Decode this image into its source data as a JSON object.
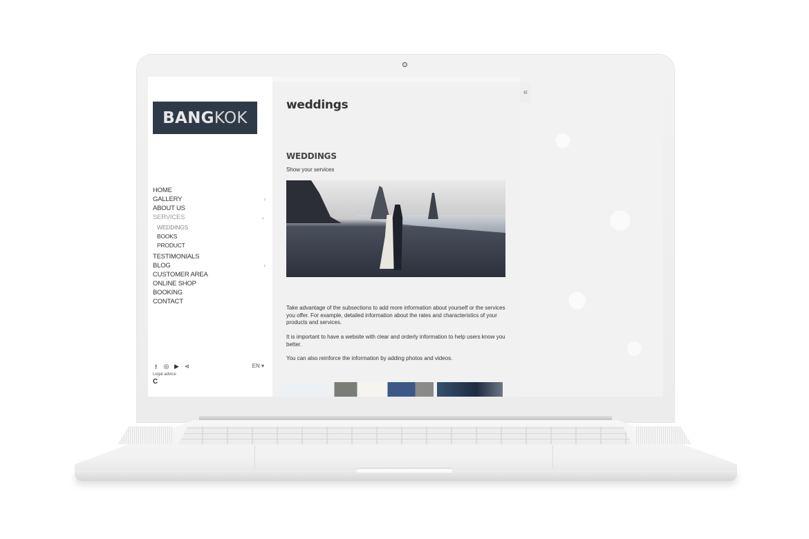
{
  "site": {
    "logo": {
      "bold": "BANG",
      "light": "KOK"
    },
    "nav": [
      {
        "label": "HOME",
        "has_submenu": false
      },
      {
        "label": "GALLERY",
        "has_submenu": true,
        "chevron": "chevron-right"
      },
      {
        "label": "ABOUT US",
        "has_submenu": false
      },
      {
        "label": "SERVICES",
        "has_submenu": true,
        "expanded": true,
        "chevron": "chevron-down",
        "children": [
          {
            "label": "WEDDINGS",
            "active": true
          },
          {
            "label": "BOOKS"
          },
          {
            "label": "PRODUCT"
          }
        ]
      },
      {
        "label": "TESTIMONIALS",
        "has_submenu": false
      },
      {
        "label": "BLOG",
        "has_submenu": true,
        "chevron": "chevron-right"
      },
      {
        "label": "CUSTOMER AREA",
        "has_submenu": false
      },
      {
        "label": "ONLINE SHOP",
        "has_submenu": false
      },
      {
        "label": "BOOKING",
        "has_submenu": false
      },
      {
        "label": "CONTACT",
        "has_submenu": false
      }
    ],
    "chevrons": {
      "right": "›",
      "down": "⌄"
    },
    "footer": {
      "social_icons": [
        {
          "name": "facebook-icon",
          "glyph": "f"
        },
        {
          "name": "instagram-icon",
          "glyph": "◎"
        },
        {
          "name": "youtube-icon",
          "glyph": "▶"
        },
        {
          "name": "share-icon",
          "glyph": "⋖"
        }
      ],
      "language": "EN ▾",
      "legal_advice": "Legal advice",
      "brand_icon": "C"
    }
  },
  "content": {
    "page_title": "weddings",
    "section_title": "WEDDINGS",
    "section_subtitle": "Show your services",
    "paragraphs": [
      "Take advantage of the subsections to add more information about yourself or the services you offer. For example, detailed information about the rates and characteristics of your products and services.",
      "It is important to have a website with clear and orderly information to help users know you better.",
      "You can also reinforce the information by adding photos and videos."
    ],
    "collapse_glyph": "«"
  },
  "colors": {
    "logo_bg": "#2e3a47",
    "text": "#333333",
    "muted": "#9a9a9a",
    "content_bg": "#f1f1f1"
  }
}
